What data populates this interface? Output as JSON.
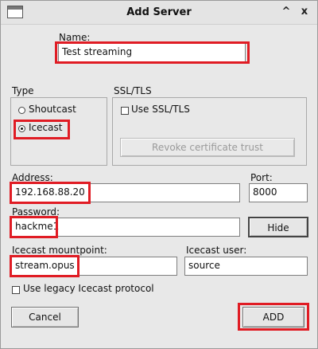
{
  "window": {
    "title": "Add Server",
    "minimize_glyph": "^",
    "close_glyph": "x"
  },
  "name": {
    "label": "Name:",
    "value": "Test streaming"
  },
  "type_group": {
    "label": "Type",
    "options": [
      {
        "label": "Shoutcast",
        "selected": false
      },
      {
        "label": "Icecast",
        "selected": true
      }
    ]
  },
  "ssl_group": {
    "label": "SSL/TLS",
    "use_ssl_label": "Use SSL/TLS",
    "use_ssl_checked": false,
    "revoke_button_label": "Revoke certificate trust"
  },
  "address": {
    "label": "Address:",
    "value": "192.168.88.20"
  },
  "port": {
    "label": "Port:",
    "value": "8000"
  },
  "password": {
    "label": "Password:",
    "value": "hackme1"
  },
  "hide_button_label": "Hide",
  "mountpoint": {
    "label": "Icecast mountpoint:",
    "value": "stream.opus"
  },
  "icecast_user": {
    "label": "Icecast user:",
    "value": "source"
  },
  "legacy": {
    "label": "Use legacy Icecast protocol",
    "checked": false
  },
  "buttons": {
    "cancel": "Cancel",
    "add": "ADD"
  },
  "colors": {
    "highlight": "#e01c24",
    "window_bg": "#e8e8e8"
  }
}
